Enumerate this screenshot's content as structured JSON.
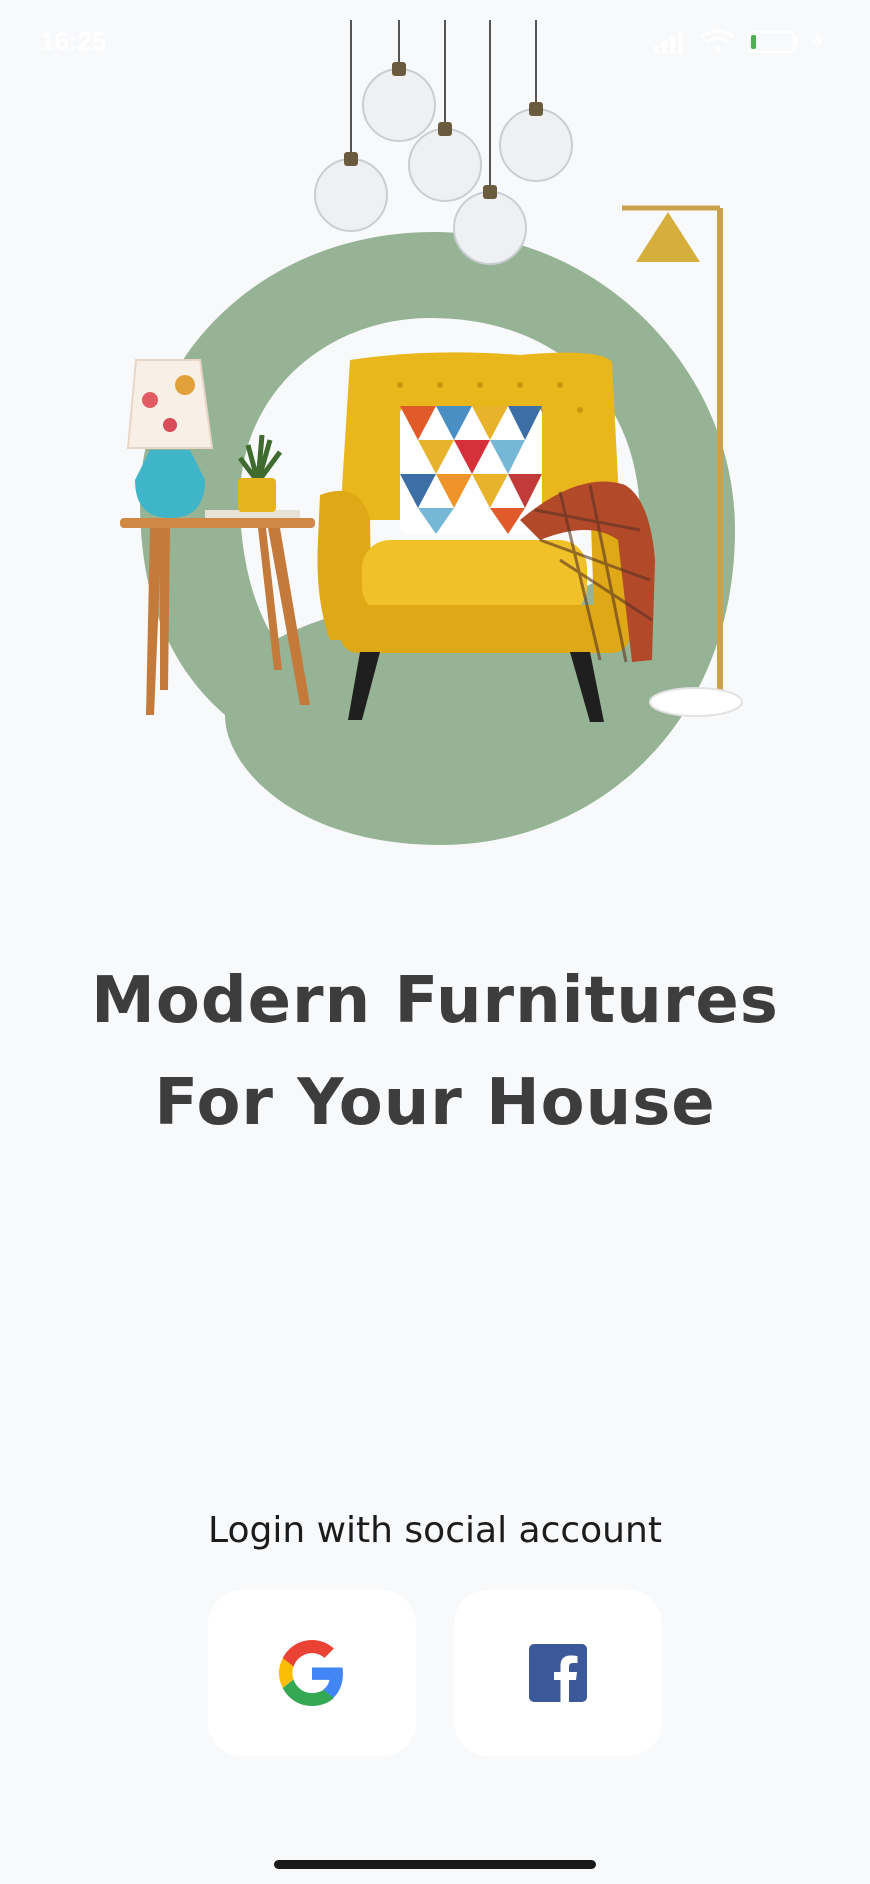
{
  "status_bar": {
    "time": "16:25",
    "icons": [
      "signal-icon",
      "wifi-icon",
      "battery-icon",
      "charging-icon"
    ]
  },
  "hero": {
    "illustration": "furniture-illustration",
    "elements": [
      "pendant-lamps",
      "green-ring",
      "side-table",
      "table-lamp",
      "potted-plant",
      "yellow-armchair",
      "patterned-cushion",
      "plaid-throw",
      "floor-lamp"
    ]
  },
  "headline": {
    "line1": "Modern Furnitures",
    "line2": "For Your House"
  },
  "login": {
    "label": "Login with social account",
    "google_icon": "google-icon",
    "facebook_icon": "facebook-icon"
  },
  "colors": {
    "background": "#f8f9fb",
    "accent_green": "#97b395",
    "chair_yellow": "#e9b61c",
    "headline": "#3d3d3d",
    "facebook_blue": "#3b5998"
  }
}
